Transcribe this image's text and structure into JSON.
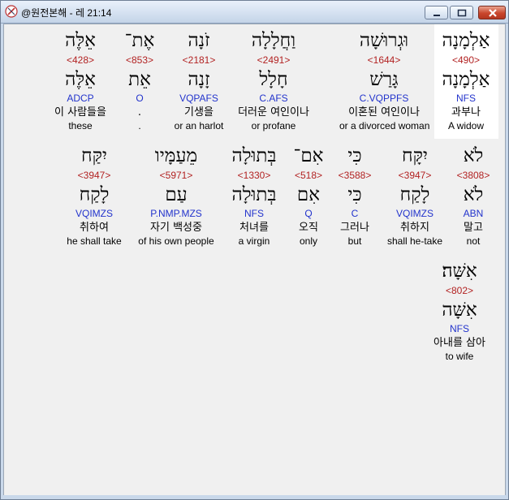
{
  "window": {
    "title": "@원전본해 - 레 21:14",
    "buttons": {
      "minimize": "minimize",
      "maximize": "maximize",
      "close": "close"
    }
  },
  "colors": {
    "strong": "#b22222",
    "morph": "#2233cc",
    "highlight": "#ffffff"
  },
  "rows": [
    [
      {
        "heb": "אַלְמָנָה",
        "strong": "<490>",
        "lemma": "אַלְמָנָה",
        "morph": "NFS",
        "kor": "과부나",
        "eng": "A widow",
        "selected": true
      },
      {
        "heb": "וּגְרוּשָׁה",
        "strong": "<1644>",
        "lemma": "גָּרַשׁ",
        "morph": "C.VQPPFS",
        "kor": "이혼된 여인이나",
        "eng": "or a divorced woman"
      },
      {
        "heb": "וַחֲלָלָה",
        "strong": "<2491>",
        "lemma": "חָלָל",
        "morph": "C.AFS",
        "kor": "더러운 여인이나",
        "eng": "or profane"
      },
      {
        "heb": "זֹנָה",
        "strong": "<2181>",
        "lemma": "זָנָה",
        "morph": "VQPAFS",
        "kor": "기생을",
        "eng": "or an harlot"
      },
      {
        "heb": "אֶת־",
        "strong": "<853>",
        "lemma": "אֵת",
        "morph": "O",
        "kor": ".",
        "eng": "."
      },
      {
        "heb": "אֵלֶּה",
        "strong": "<428>",
        "lemma": "אֵלֶּה",
        "morph": "ADCP",
        "kor": "이 사람들을",
        "eng": "these"
      }
    ],
    [
      {
        "heb": "לֹא",
        "strong": "<3808>",
        "lemma": "לֹא",
        "morph": "ABN",
        "kor": "말고",
        "eng": "not"
      },
      {
        "heb": "יִקָּח",
        "strong": "<3947>",
        "lemma": "לָקַח",
        "morph": "VQIMZS",
        "kor": "취하지",
        "eng": "shall he-take"
      },
      {
        "heb": "כִּי",
        "strong": "<3588>",
        "lemma": "כִּי",
        "morph": "C",
        "kor": "그러나",
        "eng": "but"
      },
      {
        "heb": "אִם־",
        "strong": "<518>",
        "lemma": "אִם",
        "morph": "Q",
        "kor": "오직",
        "eng": "only"
      },
      {
        "heb": "בְּתוּלָה",
        "strong": "<1330>",
        "lemma": "בְּתוּלָה",
        "morph": "NFS",
        "kor": "처녀를",
        "eng": "a virgin"
      },
      {
        "heb": "מֵעַמָּיו",
        "strong": "<5971>",
        "lemma": "עַם",
        "morph": "P.NMP.MZS",
        "kor": "자기 백성중",
        "eng": "of his own people"
      },
      {
        "heb": "יִקַּח",
        "strong": "<3947>",
        "lemma": "לָקַח",
        "morph": "VQIMZS",
        "kor": "취하여",
        "eng": "he shall take"
      }
    ],
    [
      {
        "heb": "אִשָּׁה׃",
        "strong": "<802>",
        "lemma": "אִשָּׁה",
        "morph": "NFS",
        "kor": "아내를 삼아",
        "eng": "to wife"
      }
    ]
  ]
}
